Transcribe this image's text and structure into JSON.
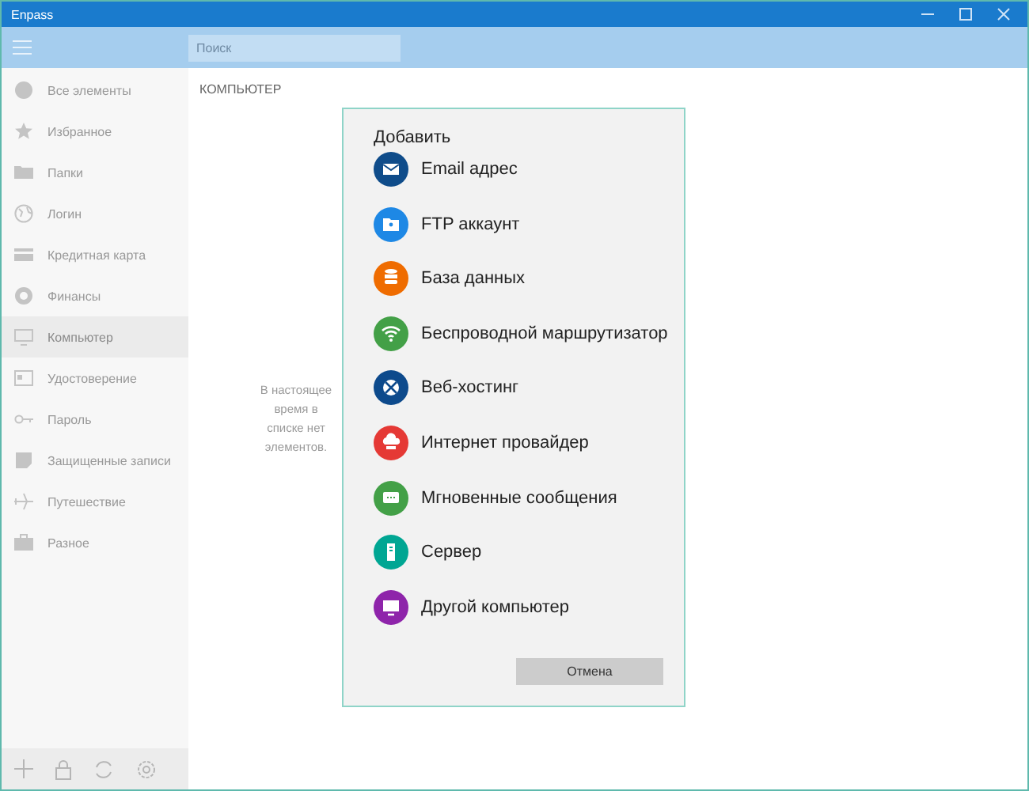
{
  "window": {
    "title": "Enpass"
  },
  "search": {
    "placeholder": "Поиск"
  },
  "sidebar": {
    "items": [
      {
        "label": "Все элементы",
        "selected": false
      },
      {
        "label": "Избранное",
        "selected": false
      },
      {
        "label": "Папки",
        "selected": false
      },
      {
        "label": "Логин",
        "selected": false
      },
      {
        "label": "Кредитная карта",
        "selected": false
      },
      {
        "label": "Финансы",
        "selected": false
      },
      {
        "label": "Компьютер",
        "selected": true
      },
      {
        "label": "Удостоверение",
        "selected": false
      },
      {
        "label": "Пароль",
        "selected": false
      },
      {
        "label": "Защищенные записи",
        "selected": false
      },
      {
        "label": "Путешествие",
        "selected": false
      },
      {
        "label": "Разное",
        "selected": false
      }
    ]
  },
  "main": {
    "heading": "КОМПЬЮТЕР",
    "empty_message": "В настоящее время в списке нет элементов."
  },
  "dialog": {
    "title": "Добавить",
    "items": [
      {
        "label": "Email адрес",
        "color": "#0f4c8a"
      },
      {
        "label": "FTP аккаунт",
        "color": "#1e88e5"
      },
      {
        "label": "База данных",
        "color": "#ef6c00"
      },
      {
        "label": "Беспроводной маршрутизатор",
        "color": "#43a047"
      },
      {
        "label": "Веб-хостинг",
        "color": "#0d4a8c"
      },
      {
        "label": "Интернет провайдер",
        "color": "#e53935"
      },
      {
        "label": "Мгновенные сообщения",
        "color": "#43a047"
      },
      {
        "label": "Сервер",
        "color": "#00a693"
      },
      {
        "label": "Другой компьютер",
        "color": "#8e24aa"
      }
    ],
    "cancel": "Отмена"
  }
}
